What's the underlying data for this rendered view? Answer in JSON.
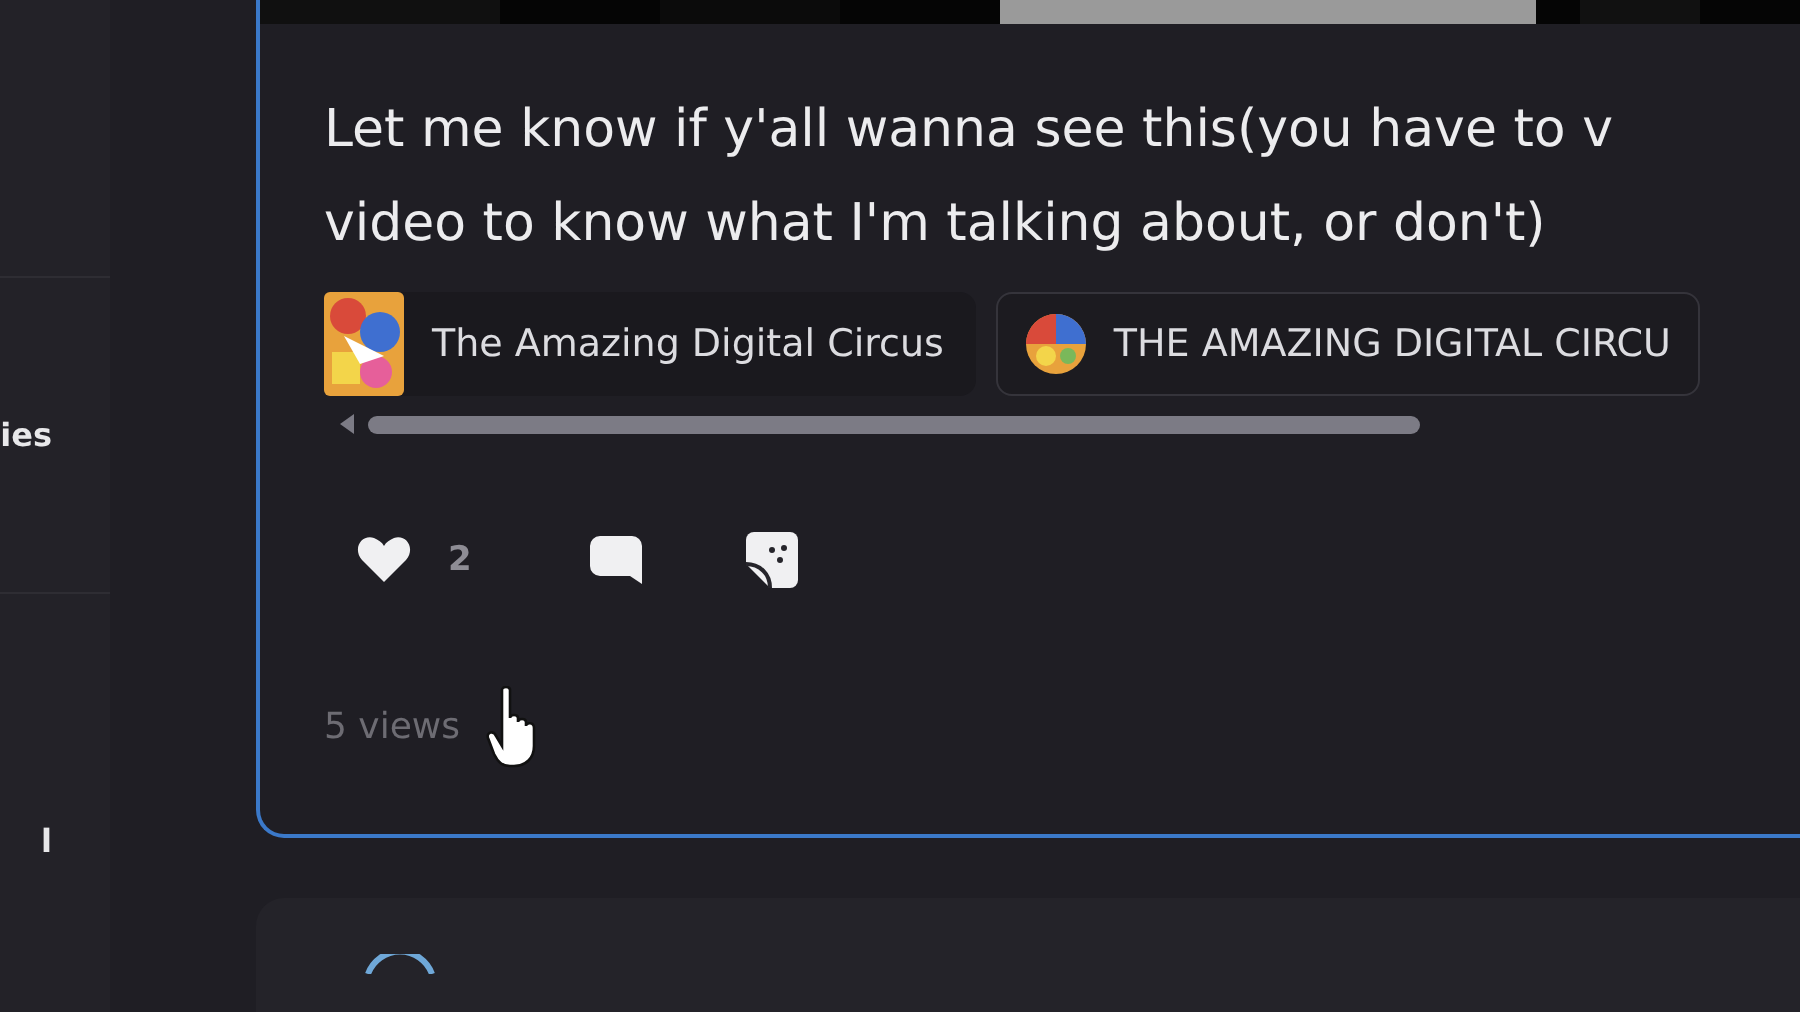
{
  "sidebar": {
    "items": [
      {
        "label": "ies"
      },
      {
        "label": "l"
      }
    ]
  },
  "post": {
    "text_lines": [
      "Let me know if y'all wanna see this(you have to v",
      "video to know what I'm talking about, or don't)"
    ],
    "tags": [
      {
        "kind": "square",
        "label": "The Amazing Digital Circus"
      },
      {
        "kind": "round",
        "label": "THE AMAZING DIGITAL CIRCU"
      }
    ],
    "likes": "2",
    "views": "5 views"
  }
}
